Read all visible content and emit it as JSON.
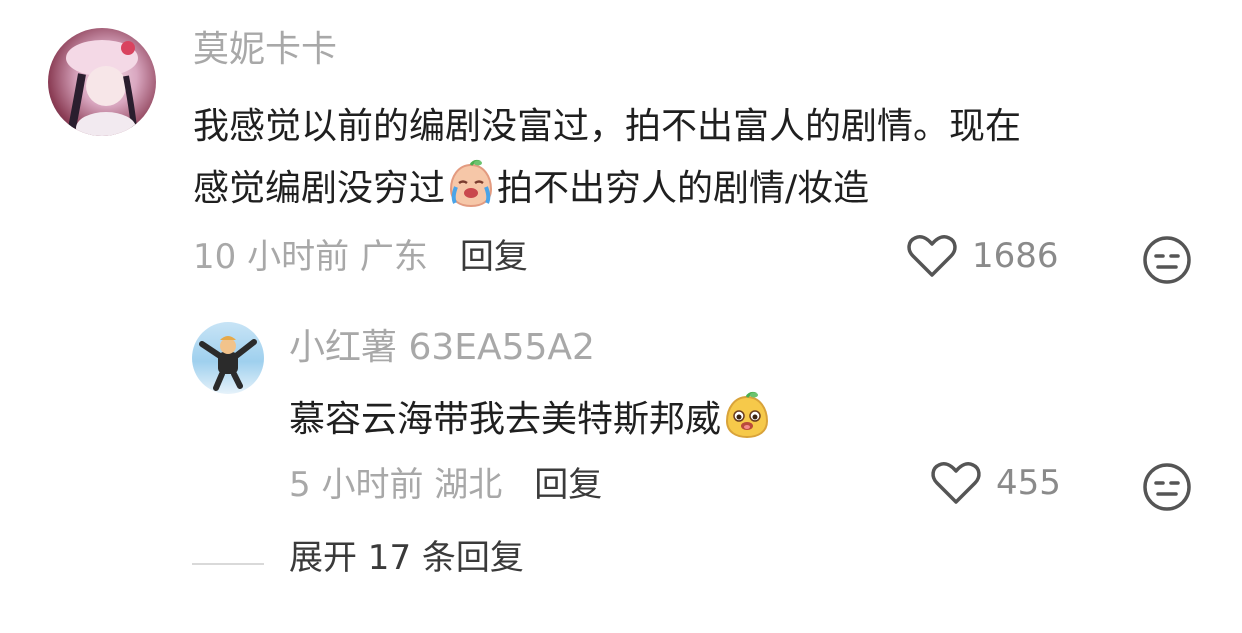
{
  "comment": {
    "username": "莫妮卡卡",
    "text_line1": "我感觉以前的编剧没富过，拍不出富人的剧情。现在",
    "text_line2_part1": "感觉编剧没穷过",
    "text_line2_emoji": "crying-peach-emoji",
    "text_line2_part2": "拍不出穷人的剧情/妆造",
    "time_location": "10 小时前 广东",
    "reply_label": "回复",
    "like_count": "1686"
  },
  "reply": {
    "username": "小红薯 63EA55A2",
    "text": "慕容云海带我去美特斯邦威",
    "text_emoji": "cheeky-peach-emoji",
    "time_location": "5 小时前 湖北",
    "reply_label": "回复",
    "like_count": "455"
  },
  "expand_label": "展开 17 条回复",
  "colors": {
    "secondary_text": "#a8a8a8",
    "primary_text": "#1f1f1f",
    "icon": "#555555",
    "emoji_peach": "#f6c7a8",
    "emoji_yellow": "#f6c94a"
  }
}
